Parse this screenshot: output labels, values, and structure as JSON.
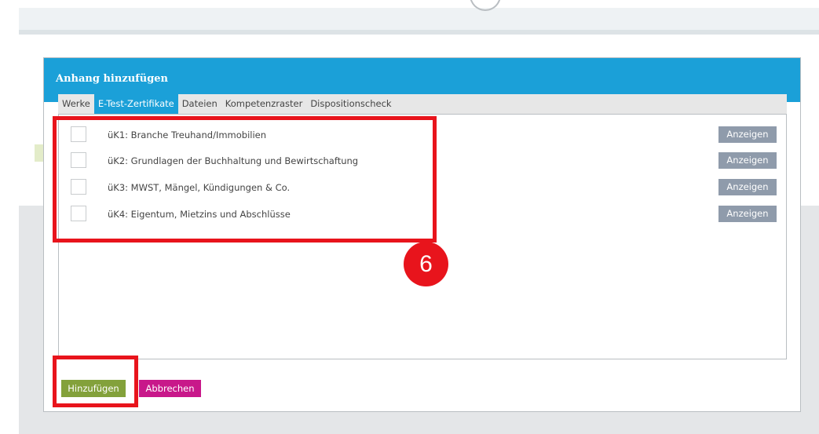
{
  "modal": {
    "title": "Anhang hinzufügen",
    "header_color": "#1ba0d8"
  },
  "tabs": [
    {
      "label": "Werke",
      "active": false
    },
    {
      "label": "E-Test-Zertifikate",
      "active": true
    },
    {
      "label": "Dateien",
      "active": false
    },
    {
      "label": "Kompetenzraster",
      "active": false
    },
    {
      "label": "Dispositionscheck",
      "active": false
    }
  ],
  "certificates": [
    {
      "label": "üK1: Branche Treuhand/Immobilien",
      "checked": false,
      "button": "Anzeigen"
    },
    {
      "label": "üK2: Grundlagen der Buchhaltung und Bewirtschaftung",
      "checked": false,
      "button": "Anzeigen"
    },
    {
      "label": "üK3: MWST, Mängel, Kündigungen & Co.",
      "checked": false,
      "button": "Anzeigen"
    },
    {
      "label": "üK4: Eigentum, Mietzins und Abschlüsse",
      "checked": false,
      "button": "Anzeigen"
    }
  ],
  "footer": {
    "add_label": "Hinzufügen",
    "cancel_label": "Abbrechen",
    "add_color": "#83a13b",
    "cancel_color": "#c8188a"
  },
  "annotation": {
    "marker_number": "6",
    "highlight_color": "#e8141c"
  }
}
